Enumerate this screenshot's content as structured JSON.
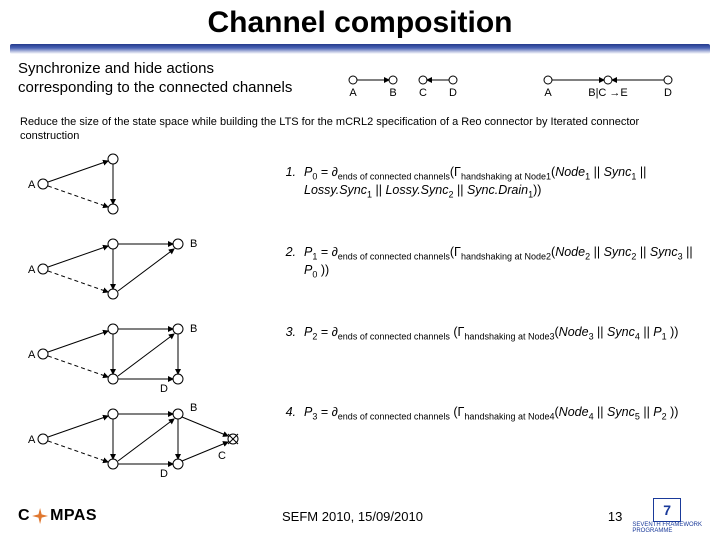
{
  "title": "Channel composition",
  "sync_text_line1": "Synchronize and hide actions",
  "sync_text_line2": "corresponding to the connected channels",
  "chain_labels": {
    "A": "A",
    "B": "B",
    "C": "C",
    "D": "D",
    "A2": "A",
    "BCE": "B|C →E",
    "D2": "D"
  },
  "reduce_text": "Reduce the size of the state space while building the LTS for the mCRL2 specification of a Reo connector by Iterated connector construction",
  "steps": {
    "s1_num": "1.",
    "s2_num": "2.",
    "s3_num": "3.",
    "s4_num": "4."
  },
  "diagA": "A",
  "diagB": "B",
  "diagC": "C",
  "diagD": "D",
  "footer_center": "SEFM 2010, 15/09/2010",
  "page_number": "13",
  "compas": {
    "c": "C",
    "mpas": "MPAS"
  },
  "fp7": "7"
}
